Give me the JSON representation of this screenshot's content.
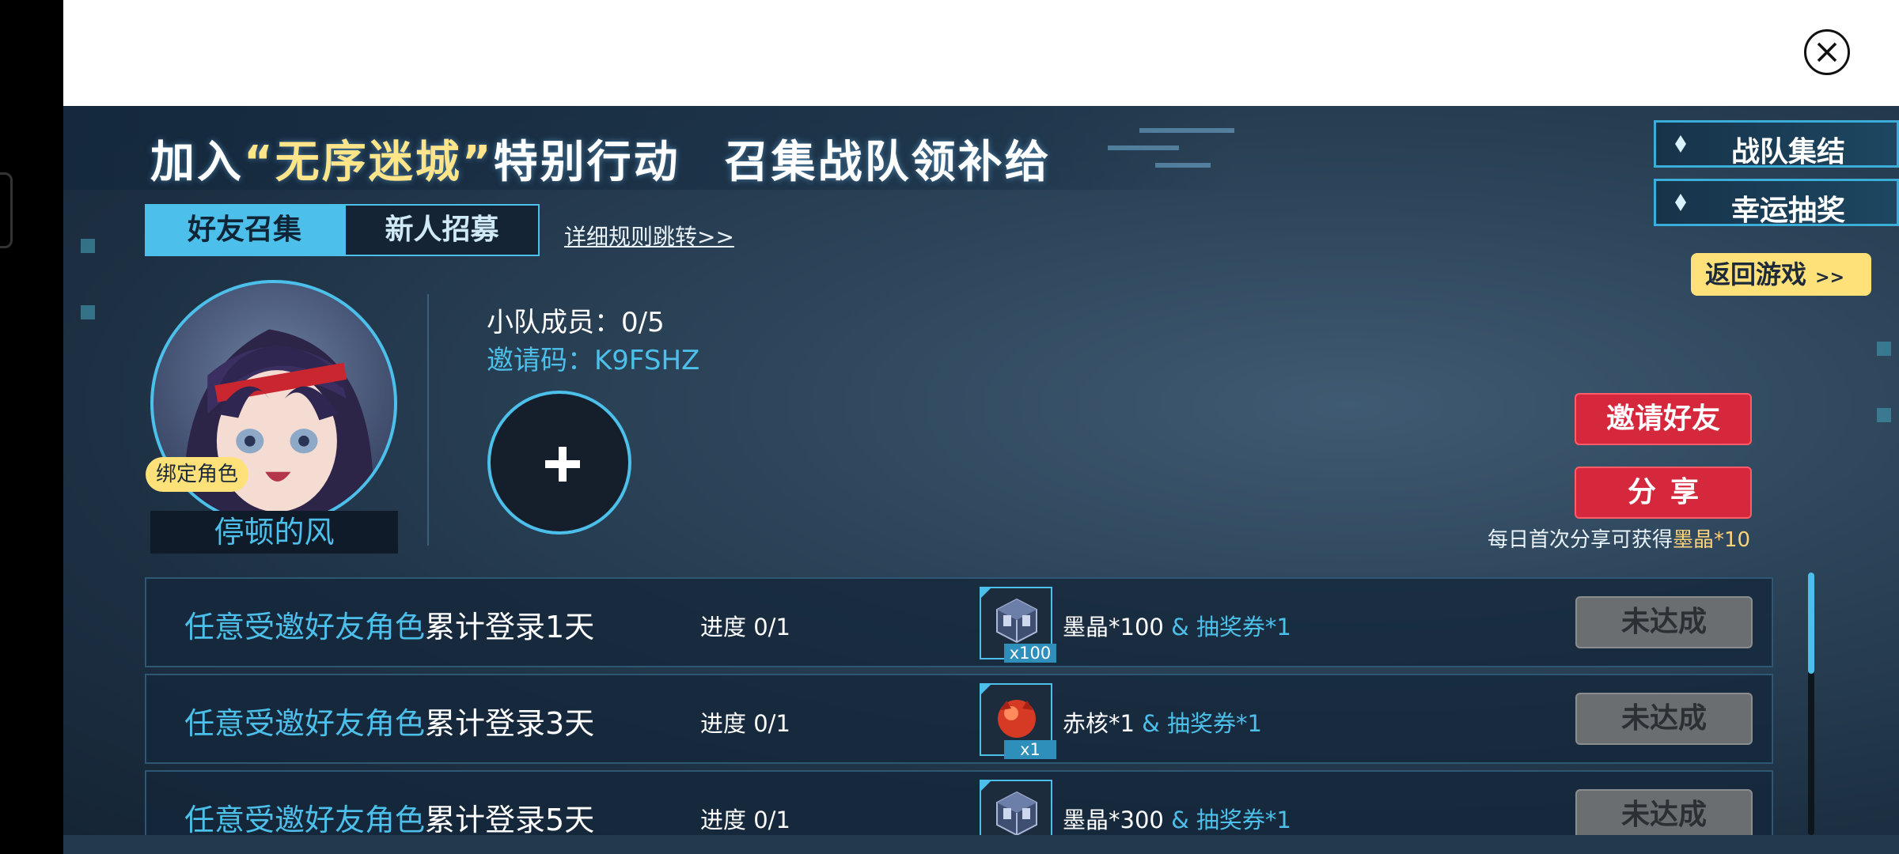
{
  "banner": {
    "title_part1": "加入",
    "title_highlight": "“无序迷城”",
    "title_part2": "特别行动",
    "title_part3": "召集战队领补给"
  },
  "side_tabs": [
    {
      "label": "战队集结"
    },
    {
      "label": "幸运抽奖"
    }
  ],
  "return_button": {
    "label": "返回游戏",
    "arrows": ">>"
  },
  "tabs": [
    {
      "label": "好友召集",
      "active": true
    },
    {
      "label": "新人招募",
      "active": false
    }
  ],
  "rules_link": "详细规则跳转>>",
  "profile": {
    "bind_badge": "绑定角色",
    "name": "停顿的风"
  },
  "team": {
    "members_label": "小队成员：",
    "members_value": "0/5",
    "invite_label": "邀请码：",
    "invite_code": "K9FSHZ"
  },
  "actions": {
    "invite_label": "邀请好友",
    "share_label": "分享",
    "share_tip_prefix": "每日首次分享可获得",
    "share_tip_reward": "墨晶*10"
  },
  "tasks": [
    {
      "title_blue": "任意受邀好友角色",
      "title_white": "累计登录1天",
      "progress": "进度 0/1",
      "reward_icon": "crystal-cube-icon",
      "reward_qty": "x100",
      "reward_main": "墨晶*100",
      "reward_extra": "& 抽奖券*1",
      "status": "未达成"
    },
    {
      "title_blue": "任意受邀好友角色",
      "title_white": "累计登录3天",
      "progress": "进度 0/1",
      "reward_icon": "red-core-icon",
      "reward_qty": "x1",
      "reward_main": "赤核*1",
      "reward_extra": "& 抽奖券*1",
      "status": "未达成"
    },
    {
      "title_blue": "任意受邀好友角色",
      "title_white": "累计登录5天",
      "progress": "进度 0/1",
      "reward_icon": "crystal-cube-icon",
      "reward_qty": "",
      "reward_main": "墨晶*300",
      "reward_extra": "& 抽奖券*1",
      "status": "未达成"
    }
  ],
  "colors": {
    "accent_blue": "#4cc0ea",
    "accent_yellow": "#ffe17a",
    "action_red": "#d5283c",
    "disabled_gray": "#6b6e71"
  }
}
